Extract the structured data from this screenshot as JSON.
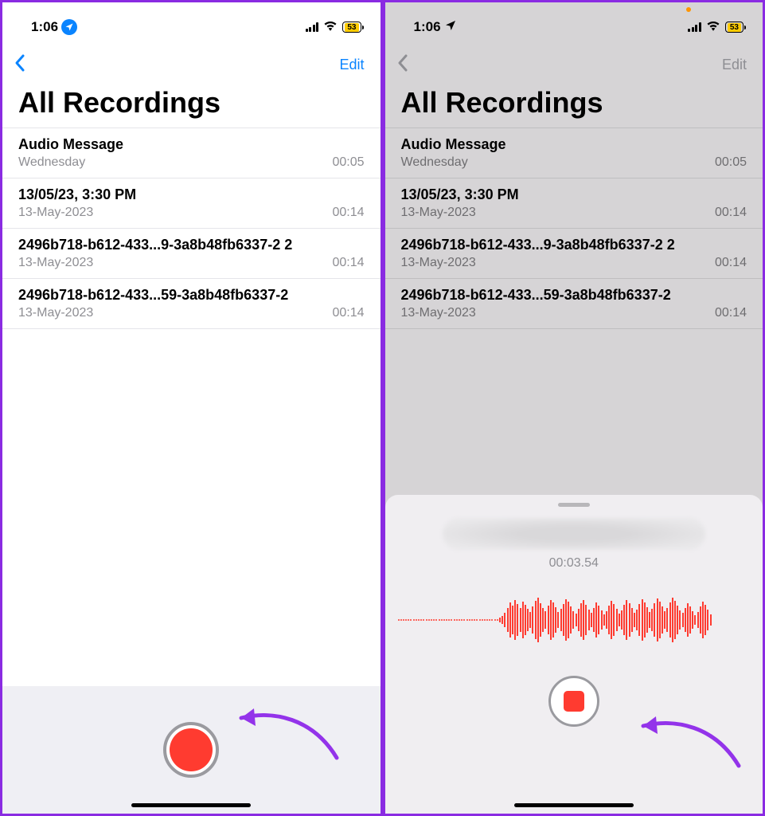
{
  "status": {
    "time": "1:06",
    "battery": "53"
  },
  "nav": {
    "edit": "Edit"
  },
  "title": "All Recordings",
  "recordings": [
    {
      "title": "Audio Message",
      "date": "Wednesday",
      "dur": "00:05"
    },
    {
      "title": "13/05/23, 3:30 PM",
      "date": "13-May-2023",
      "dur": "00:14"
    },
    {
      "title": "2496b718-b612-433...9-3a8b48fb6337-2 2",
      "date": "13-May-2023",
      "dur": "00:14"
    },
    {
      "title": "2496b718-b612-433...59-3a8b48fb6337-2",
      "date": "13-May-2023",
      "dur": "00:14"
    }
  ],
  "recording_panel": {
    "timer": "00:03.54"
  }
}
